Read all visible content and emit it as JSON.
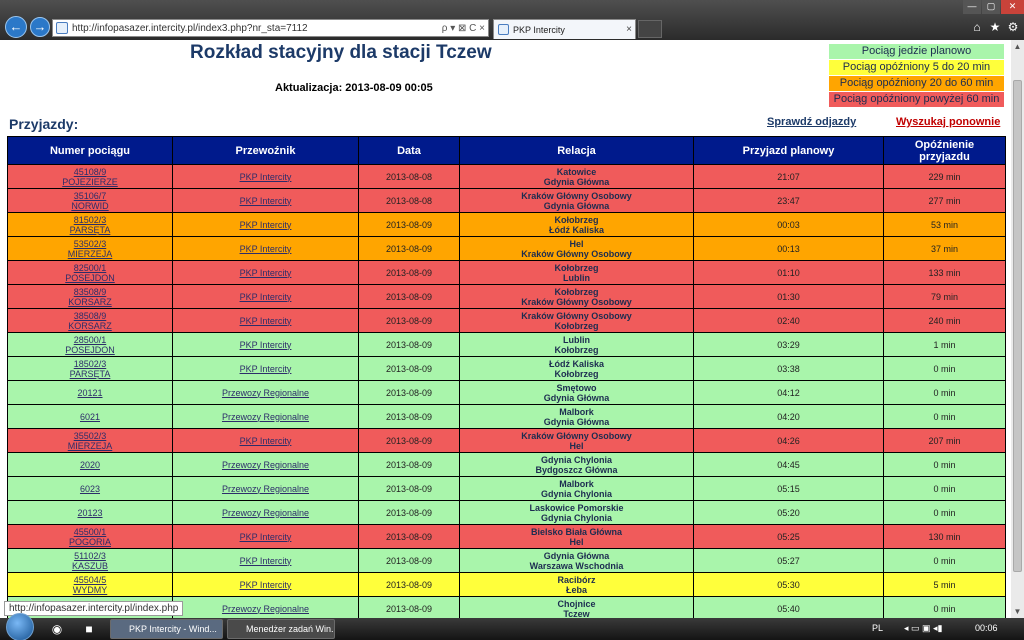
{
  "browser": {
    "url": "http://infopasazer.intercity.pl/index3.php?nr_sta=7112",
    "address_tools": "ρ ▾ ⊠ C ×",
    "tab_title": "PKP Intercity",
    "tab_close": "×",
    "min": "—",
    "max": "▢",
    "close": "✕",
    "home_icon": "⌂",
    "fav_icon": "★",
    "settings_icon": "⚙",
    "back_icon": "←",
    "forward_icon": "→"
  },
  "page": {
    "title": "Rozkład stacyjny dla stacji Tczew",
    "update": "Aktualizacja: 2013-08-09 00:05",
    "section_title": "Przyjazdy:",
    "check_departures": "Sprawdź odjazdy",
    "search_again": "Wyszukaj ponownie"
  },
  "legend": [
    {
      "label": "Pociąg jedzie planowo",
      "color": "#a9f5ab"
    },
    {
      "label": "Pociąg opóźniony 5 do 20 min",
      "color": "#ffff3b"
    },
    {
      "label": "Pociąg opóźniony 20 do 60 min",
      "color": "#ffa500"
    },
    {
      "label": "Pociąg opóźniony powyżej 60 min",
      "color": "#f05b5b"
    }
  ],
  "table": {
    "headers": [
      "Numer pociągu",
      "Przewoźnik",
      "Data",
      "Relacja",
      "Przyjazd planowy",
      "Opóźnienie przyjazdu"
    ],
    "header_delay_line1": "Opóźnienie",
    "header_delay_line2": "przyjazdu",
    "rows": [
      {
        "num1": "45108/9",
        "num2": "POJEZIERZE",
        "carrier": "PKP Intercity",
        "date": "2013-08-08",
        "rel1": "Katowice",
        "rel2": "Gdynia Główna",
        "time": "21:07",
        "delay": "229 min",
        "status": "red"
      },
      {
        "num1": "35106/7",
        "num2": "NORWID",
        "carrier": "PKP Intercity",
        "date": "2013-08-08",
        "rel1": "Kraków Główny Osobowy",
        "rel2": "Gdynia Główna",
        "time": "23:47",
        "delay": "277 min",
        "status": "red"
      },
      {
        "num1": "81502/3",
        "num2": "PARSĘTA",
        "carrier": "PKP Intercity",
        "date": "2013-08-09",
        "rel1": "Kołobrzeg",
        "rel2": "Łódź Kaliska",
        "time": "00:03",
        "delay": "53 min",
        "status": "orange"
      },
      {
        "num1": "53502/3",
        "num2": "MIERZEJA",
        "carrier": "PKP Intercity",
        "date": "2013-08-09",
        "rel1": "Hel",
        "rel2": "Kraków Główny Osobowy",
        "time": "00:13",
        "delay": "37 min",
        "status": "orange"
      },
      {
        "num1": "82500/1",
        "num2": "POSEJDON",
        "carrier": "PKP Intercity",
        "date": "2013-08-09",
        "rel1": "Kołobrzeg",
        "rel2": "Lublin",
        "time": "01:10",
        "delay": "133 min",
        "status": "red"
      },
      {
        "num1": "83508/9",
        "num2": "KORSARZ",
        "carrier": "PKP Intercity",
        "date": "2013-08-09",
        "rel1": "Kołobrzeg",
        "rel2": "Kraków Główny Osobowy",
        "time": "01:30",
        "delay": "79 min",
        "status": "red"
      },
      {
        "num1": "38508/9",
        "num2": "KORSARZ",
        "carrier": "PKP Intercity",
        "date": "2013-08-09",
        "rel1": "Kraków Główny Osobowy",
        "rel2": "Kołobrzeg",
        "time": "02:40",
        "delay": "240 min",
        "status": "red"
      },
      {
        "num1": "28500/1",
        "num2": "POSEJDON",
        "carrier": "PKP Intercity",
        "date": "2013-08-09",
        "rel1": "Lublin",
        "rel2": "Kołobrzeg",
        "time": "03:29",
        "delay": "1 min",
        "status": "green"
      },
      {
        "num1": "18502/3",
        "num2": "PARSĘTA",
        "carrier": "PKP Intercity",
        "date": "2013-08-09",
        "rel1": "Łódź Kaliska",
        "rel2": "Kołobrzeg",
        "time": "03:38",
        "delay": "0 min",
        "status": "green"
      },
      {
        "num1": "20121",
        "num2": "",
        "carrier": "Przewozy Regionalne",
        "date": "2013-08-09",
        "rel1": "Smętowo",
        "rel2": "Gdynia Główna",
        "time": "04:12",
        "delay": "0 min",
        "status": "green"
      },
      {
        "num1": "6021",
        "num2": "",
        "carrier": "Przewozy Regionalne",
        "date": "2013-08-09",
        "rel1": "Malbork",
        "rel2": "Gdynia Główna",
        "time": "04:20",
        "delay": "0 min",
        "status": "green"
      },
      {
        "num1": "35502/3",
        "num2": "MIERZEJA",
        "carrier": "PKP Intercity",
        "date": "2013-08-09",
        "rel1": "Kraków Główny Osobowy",
        "rel2": "Hel",
        "time": "04:26",
        "delay": "207 min",
        "status": "red"
      },
      {
        "num1": "2020",
        "num2": "",
        "carrier": "Przewozy Regionalne",
        "date": "2013-08-09",
        "rel1": "Gdynia Chylonia",
        "rel2": "Bydgoszcz Główna",
        "time": "04:45",
        "delay": "0 min",
        "status": "green"
      },
      {
        "num1": "6023",
        "num2": "",
        "carrier": "Przewozy Regionalne",
        "date": "2013-08-09",
        "rel1": "Malbork",
        "rel2": "Gdynia Chylonia",
        "time": "05:15",
        "delay": "0 min",
        "status": "green"
      },
      {
        "num1": "20123",
        "num2": "",
        "carrier": "Przewozy Regionalne",
        "date": "2013-08-09",
        "rel1": "Laskowice Pomorskie",
        "rel2": "Gdynia Chylonia",
        "time": "05:20",
        "delay": "0 min",
        "status": "green"
      },
      {
        "num1": "45500/1",
        "num2": "POGORIA",
        "carrier": "PKP Intercity",
        "date": "2013-08-09",
        "rel1": "Bielsko Biała Główna",
        "rel2": "Hel",
        "time": "05:25",
        "delay": "130 min",
        "status": "red"
      },
      {
        "num1": "51102/3",
        "num2": "KASZUB",
        "carrier": "PKP Intercity",
        "date": "2013-08-09",
        "rel1": "Gdynia Główna",
        "rel2": "Warszawa Wschodnia",
        "time": "05:27",
        "delay": "0 min",
        "status": "green"
      },
      {
        "num1": "45504/5",
        "num2": "WYDMY",
        "carrier": "PKP Intercity",
        "date": "2013-08-09",
        "rel1": "Racibórz",
        "rel2": "Łeba",
        "time": "05:30",
        "delay": "5 min",
        "status": "yellow"
      },
      {
        "num1": "",
        "num2": "",
        "carrier": "Przewozy Regionalne",
        "date": "2013-08-09",
        "rel1": "Chojnice",
        "rel2": "Tczew",
        "time": "05:40",
        "delay": "0 min",
        "status": "green"
      }
    ]
  },
  "status_bar": {
    "link_preview": "http://infopasazer.intercity.pl/index.php"
  },
  "taskbar": {
    "tasks": [
      "PKP Intercity - Wind...",
      "Menedżer zadań Win..."
    ],
    "lang": "PL",
    "time": "00:06"
  }
}
